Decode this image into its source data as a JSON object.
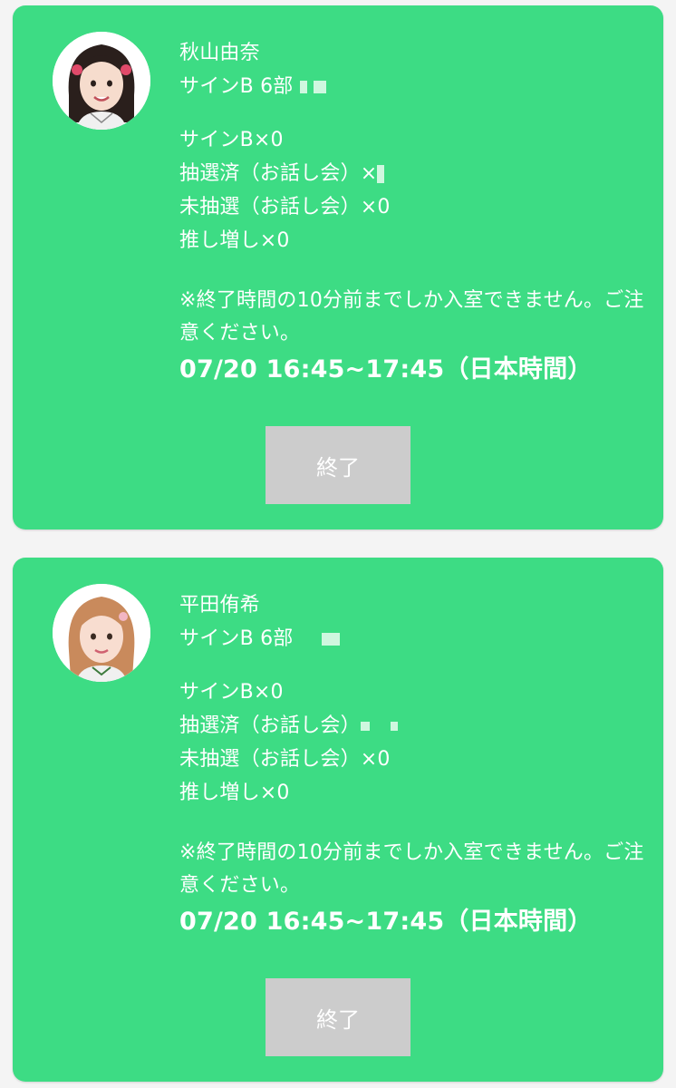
{
  "cards": [
    {
      "name": "秋山由奈",
      "session": "サインB 6部",
      "sign_count": "サインB×0",
      "drawn": "抽選済（お話し会）×",
      "undrawn": "未抽選（お話し会）×0",
      "oshi": "推し増し×0",
      "note": "※終了時間の10分前までしか入室できません。ご注意ください。",
      "datetime": "07/20 16:45~17:45（日本時間）",
      "button_label": "終了"
    },
    {
      "name": "平田侑希",
      "session": "サインB 6部",
      "sign_count": "サインB×0",
      "drawn": "抽選済（お話し会）",
      "undrawn": "未抽選（お話し会）×0",
      "oshi": "推し増し×0",
      "note": "※終了時間の10分前までしか入室できません。ご注意ください。",
      "datetime": "07/20 16:45~17:45（日本時間）",
      "button_label": "終了"
    }
  ],
  "colors": {
    "card_bg": "#3ddc84",
    "button_bg": "#cccccc",
    "page_bg": "#f4f4f4"
  }
}
